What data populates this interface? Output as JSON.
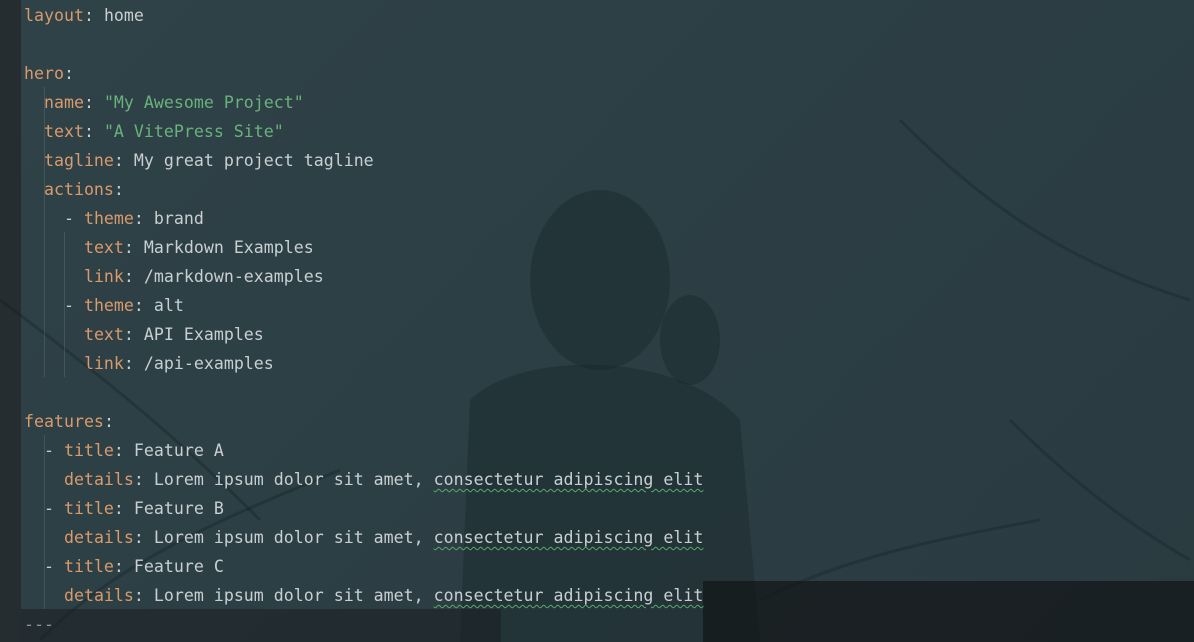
{
  "editor": {
    "lines": [
      {
        "indent": "",
        "key": "layout",
        "colon": ": ",
        "value": "home"
      },
      {
        "indent": "",
        "blank": true
      },
      {
        "indent": "",
        "key": "hero",
        "colon": ":"
      },
      {
        "indent": "  ",
        "key": "name",
        "colon": ": ",
        "string": "\"My Awesome Project\""
      },
      {
        "indent": "  ",
        "key": "text",
        "colon": ": ",
        "string": "\"A VitePress Site\""
      },
      {
        "indent": "  ",
        "key": "tagline",
        "colon": ": ",
        "value": "My great project tagline"
      },
      {
        "indent": "  ",
        "key": "actions",
        "colon": ":"
      },
      {
        "indent": "    ",
        "dash": "- ",
        "key": "theme",
        "colon": ": ",
        "value": "brand"
      },
      {
        "indent": "      ",
        "key": "text",
        "colon": ": ",
        "value": "Markdown Examples"
      },
      {
        "indent": "      ",
        "key": "link",
        "colon": ": ",
        "value": "/markdown-examples"
      },
      {
        "indent": "    ",
        "dash": "- ",
        "key": "theme",
        "colon": ": ",
        "value": "alt"
      },
      {
        "indent": "      ",
        "key": "text",
        "colon": ": ",
        "value": "API Examples"
      },
      {
        "indent": "      ",
        "key": "link",
        "colon": ": ",
        "value": "/api-examples"
      },
      {
        "indent": "",
        "blank": true
      },
      {
        "indent": "",
        "key": "features",
        "colon": ":"
      },
      {
        "indent": "  ",
        "dash": "- ",
        "key": "title",
        "colon": ": ",
        "value": "Feature A"
      },
      {
        "indent": "    ",
        "key": "details",
        "colon": ": ",
        "value": "Lorem ipsum dolor sit amet, ",
        "typo": "consectetur adipiscing elit"
      },
      {
        "indent": "  ",
        "dash": "- ",
        "key": "title",
        "colon": ": ",
        "value": "Feature B"
      },
      {
        "indent": "    ",
        "key": "details",
        "colon": ": ",
        "value": "Lorem ipsum dolor sit amet, ",
        "typo": "consectetur adipiscing elit"
      },
      {
        "indent": "  ",
        "dash": "- ",
        "key": "title",
        "colon": ": ",
        "value": "Feature C"
      },
      {
        "indent": "    ",
        "key": "details",
        "colon": ": ",
        "value": "Lorem ipsum dolor sit amet, ",
        "typo": "consectetur adipiscing elit"
      },
      {
        "indent": "",
        "separator": "---"
      }
    ]
  },
  "colors": {
    "background": "#2c3f45",
    "key": "#d99a6c",
    "string": "#6ab27c",
    "text": "#c9cfd1",
    "gutter": "#262d30",
    "spellcheck_underline": "#5aa86a"
  }
}
